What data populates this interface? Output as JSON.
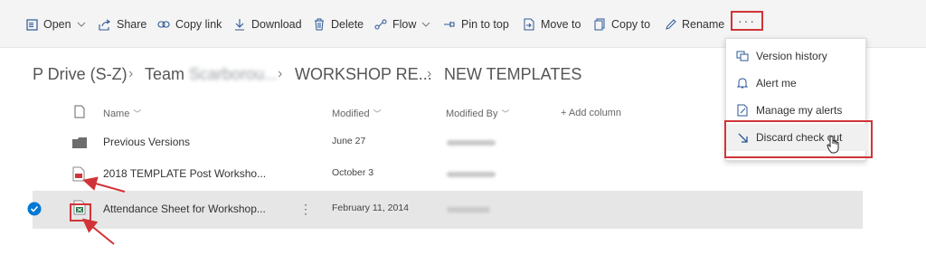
{
  "toolbar": {
    "open": "Open",
    "share": "Share",
    "copy_link": "Copy link",
    "download": "Download",
    "delete": "Delete",
    "flow": "Flow",
    "pin_to_top": "Pin to top",
    "move_to": "Move to",
    "copy_to": "Copy to",
    "rename": "Rename",
    "more": "···"
  },
  "breadcrumb": {
    "root": "P Drive (S-Z)",
    "team_prefix": "Team",
    "team_name_blurred": "Scarborou...",
    "folder1": "WORKSHOP RE...",
    "current": "NEW TEMPLATES"
  },
  "columns": {
    "name": "Name",
    "modified": "Modified",
    "modified_by": "Modified By",
    "add_column": "+ Add column"
  },
  "rows": [
    {
      "name": "Previous Versions",
      "modified": "June 27",
      "modified_by": "Ken Scarbridge",
      "type": "folder"
    },
    {
      "name": "2018 TEMPLATE Post Worksho...",
      "modified": "October 3",
      "modified_by": "Ken Scarbridge",
      "type": "pdf"
    },
    {
      "name": "Attendance Sheet for Workshop...",
      "modified": "February 11, 2014",
      "modified_by": "John Patton",
      "type": "excel",
      "selected": true
    }
  ],
  "menu": {
    "items": [
      {
        "label": "Version history",
        "icon": "version-history-icon"
      },
      {
        "label": "Alert me",
        "icon": "bell-icon"
      },
      {
        "label": "Manage my alerts",
        "icon": "manage-alerts-icon"
      },
      {
        "label": "Discard check out",
        "icon": "discard-checkout-icon"
      }
    ]
  },
  "colors": {
    "accent": "#2b5797",
    "annotation_red": "#d13438",
    "selected_row": "#e6e6e6",
    "checkmark": "#0078d4"
  }
}
